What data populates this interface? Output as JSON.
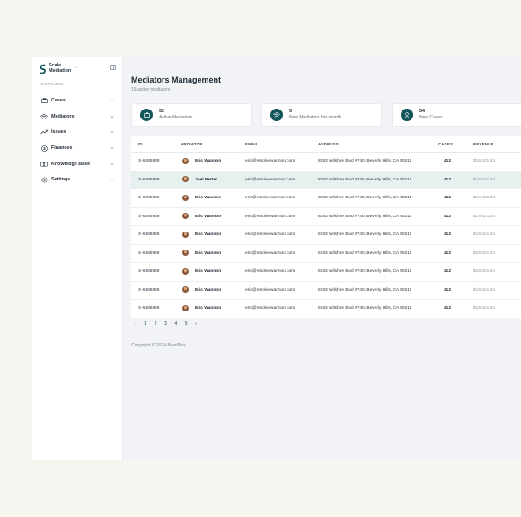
{
  "brand": {
    "line1": "Scale",
    "line2": "Mediation",
    "chevron": "⌄"
  },
  "sidebar": {
    "section_label": "EXPLORE",
    "items": [
      {
        "label": "Cases",
        "icon": "briefcase-icon"
      },
      {
        "label": "Mediators",
        "icon": "group-icon"
      },
      {
        "label": "Issues",
        "icon": "trend-icon"
      },
      {
        "label": "Finances",
        "icon": "dollar-icon"
      },
      {
        "label": "Knowledge Base",
        "icon": "book-icon"
      },
      {
        "label": "Settings",
        "icon": "gear-icon"
      }
    ],
    "chevron": "⌄"
  },
  "header": {
    "title": "Mediators Management",
    "subtitle": "15 active mediators"
  },
  "stats": [
    {
      "value": "52",
      "label": "Active Mediators"
    },
    {
      "value": "5",
      "label": "New Mediators this month"
    },
    {
      "value": "54",
      "label": "New Cases"
    }
  ],
  "table": {
    "columns": [
      "ID",
      "MEDIATOR",
      "EMAIL",
      "ADDRESS",
      "CASES",
      "REVENUE"
    ],
    "rows": [
      {
        "id": "S-6385949",
        "mediator": "Eric Wannon",
        "email": "eric@resolvewannon.com",
        "address": "8383 Wilshire Blvd #740, Beverly Hills, CA 90211",
        "cases": "412",
        "revenue": "$19,421.34"
      },
      {
        "id": "S-6385949",
        "mediator": "Joel Bertet",
        "email": "eric@resolvewannon.com",
        "address": "8383 Wilshire Blvd #740, Beverly Hills, CA 90211",
        "cases": "412",
        "revenue": "$19,421.34"
      },
      {
        "id": "S-6385949",
        "mediator": "Eric Wannon",
        "email": "eric@resolvewannon.com",
        "address": "8383 Wilshire Blvd #740, Beverly Hills, CA 90211",
        "cases": "412",
        "revenue": "$19,421.34"
      },
      {
        "id": "S-6385949",
        "mediator": "Eric Wannon",
        "email": "eric@resolvewannon.com",
        "address": "8383 Wilshire Blvd #740, Beverly Hills, CA 90211",
        "cases": "412",
        "revenue": "$19,421.34"
      },
      {
        "id": "S-6385949",
        "mediator": "Eric Wannon",
        "email": "eric@resolvewannon.com",
        "address": "8383 Wilshire Blvd #740, Beverly Hills, CA 90211",
        "cases": "412",
        "revenue": "$19,421.34"
      },
      {
        "id": "S-6385949",
        "mediator": "Eric Wannon",
        "email": "eric@resolvewannon.com",
        "address": "8383 Wilshire Blvd #740, Beverly Hills, CA 90211",
        "cases": "412",
        "revenue": "$19,421.34"
      },
      {
        "id": "S-6385949",
        "mediator": "Eric Wannon",
        "email": "eric@resolvewannon.com",
        "address": "8383 Wilshire Blvd #740, Beverly Hills, CA 90211",
        "cases": "412",
        "revenue": "$19,421.34"
      },
      {
        "id": "S-6385949",
        "mediator": "Eric Wannon",
        "email": "eric@resolvewannon.com",
        "address": "8383 Wilshire Blvd #740, Beverly Hills, CA 90211",
        "cases": "412",
        "revenue": "$19,421.34"
      },
      {
        "id": "S-6385949",
        "mediator": "Eric Wannon",
        "email": "eric@resolvewannon.com",
        "address": "8383 Wilshire Blvd #740, Beverly Hills, CA 90211",
        "cases": "412",
        "revenue": "$19,421.34"
      }
    ],
    "selected_row": 1
  },
  "pagination": {
    "prev": "‹",
    "pages": [
      "1",
      "2",
      "3",
      "4",
      "5"
    ],
    "next": "›",
    "current": "1"
  },
  "footer": {
    "copyright": "Copyright © 2024 BearPlex"
  },
  "colors": {
    "accent": "#12555a",
    "selected_row": "#e6f0ee",
    "background": "#f1f3f6"
  }
}
